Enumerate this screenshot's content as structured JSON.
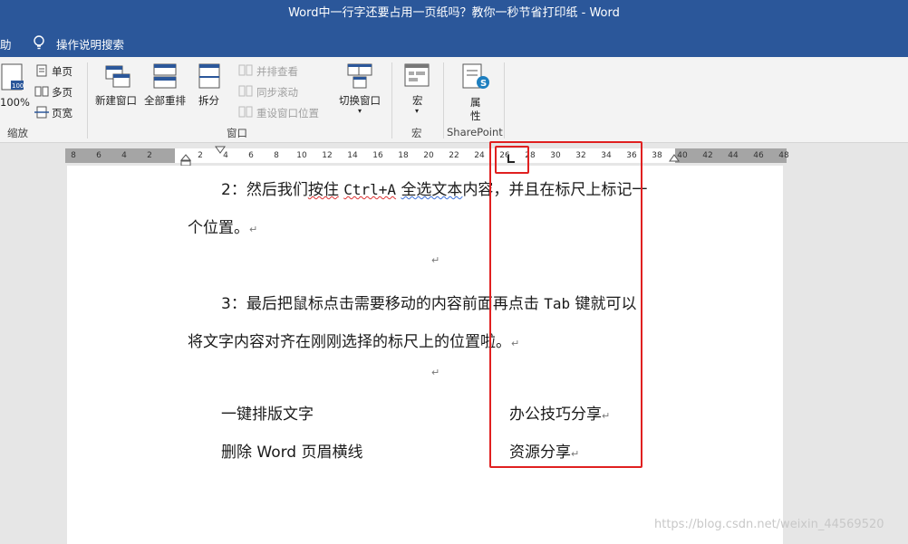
{
  "window": {
    "title": "Word中一行字还要占用一页纸吗？教你一秒节省打印纸  -  Word"
  },
  "tellbar": {
    "left_fragment": "助",
    "tell_me": "操作说明搜索"
  },
  "ribbon": {
    "zoom": {
      "percent_label": "100%",
      "one_page": "单页",
      "multi_page": "多页",
      "page_width": "页宽",
      "group": "缩放"
    },
    "window": {
      "new_window": "新建窗口",
      "arrange_all": "全部重排",
      "split": "拆分",
      "view_side_by_side": "并排查看",
      "sync_scroll": "同步滚动",
      "reset_window": "重设窗口位置",
      "switch_window": "切换窗口",
      "group": "窗口"
    },
    "macros": {
      "label": "宏",
      "group": "宏"
    },
    "sharepoint": {
      "label_line1": "属",
      "label_line2": "性",
      "group": "SharePoint"
    }
  },
  "ruler": {
    "left_ticks": [
      "8",
      "6",
      "4",
      "2"
    ],
    "ticks": [
      "2",
      "4",
      "6",
      "8",
      "10",
      "12",
      "14",
      "16",
      "18",
      "20",
      "22",
      "24",
      "26",
      "28",
      "30",
      "32",
      "34",
      "36",
      "38"
    ],
    "right_ticks": [
      "40",
      "42",
      "44",
      "46",
      "48"
    ]
  },
  "document": {
    "p1_prefix": "2：然后我们",
    "p1_underlined_red": "按住",
    "p1_mid_space": " ",
    "p1_code": "Ctrl+A",
    "p1_space2": " ",
    "p1_underlined_blue": "全选文本",
    "p1_suffix": "内容，并且在标尺上标记一",
    "p1_line2": "个位置。",
    "p3_prefix": "3：最后把鼠标点击需要移动的内容前面再点击 ",
    "p3_code": "Tab",
    "p3_suffix": " 键就可以",
    "p3_line2": "将文字内容对齐在刚刚选择的标尺上的位置啦。",
    "row1_left": "一键排版文字",
    "row1_right": "办公技巧分享",
    "row2_left": "删除 Word 页眉横线",
    "row2_right": "资源分享",
    "para_mark": "↵"
  },
  "watermark": "https://blog.csdn.net/weixin_44569520",
  "colors": {
    "titlebar": "#2b579a",
    "highlight": "#e02020"
  }
}
